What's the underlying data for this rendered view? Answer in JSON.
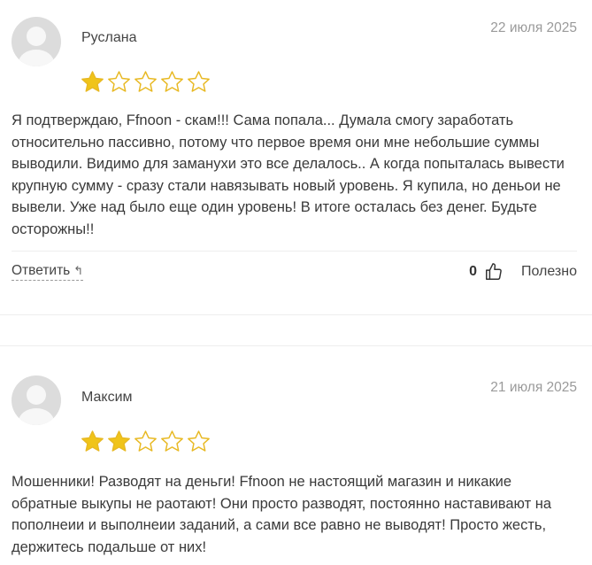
{
  "reviews": [
    {
      "author": "Руслана",
      "date": "22 июля 2025",
      "rating": 1,
      "max_rating": 5,
      "text": "Я подтверждаю, Ffnoon - скам!!! Сама попала... Думала смогу заработать относительно пассивно, потому что первое время они мне небольшие суммы выводили. Видимо для заманухи это все делалось.. А когда попыталась вывести крупную сумму - сразу стали навязывать новый уровень. Я купила, но деньои не вывели. Уже над было еще один уровень! В итоге осталась без денег. Будьте осторожны!!",
      "reply_label": "Ответить",
      "votes": "0",
      "useful_label": "Полезно"
    },
    {
      "author": "Максим",
      "date": "21 июля 2025",
      "rating": 2,
      "max_rating": 5,
      "text": "Мошенники! Разводят на деньги! Ffnoon не настоящий магазин и никакие обратные выкупы не раотают! Они просто разводят, постоянно наставивают на пополнеии и выполнеии заданий, а сами все равно не выводят! Просто жесть, держитесь подальше от них!"
    }
  ],
  "colors": {
    "star_fill": "#f0c419",
    "star_outline": "#e8b923",
    "accent_text": "#333333"
  },
  "icons": {
    "reply": "reply-arrow-icon",
    "like": "thumbs-up-icon",
    "star": "star-icon",
    "avatar": "user-avatar-icon"
  }
}
